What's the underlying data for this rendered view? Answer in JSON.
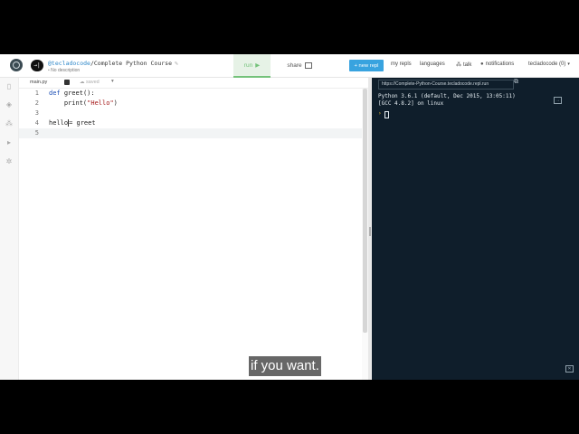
{
  "header": {
    "lang_badge": "→|",
    "user": "@tecladocode",
    "slash": "/",
    "repl_name": "Complete Python Course",
    "description": "No description",
    "run_label": "run",
    "share_label": "share",
    "new_repl_label": "+ new repl",
    "my_repls_label": "my repls",
    "languages_label": "languages",
    "talk_label": "talk",
    "notifications_label": "notifications",
    "account_label": "tecladocode (0)"
  },
  "editor": {
    "file_tab": "main.py",
    "saved_label": "saved",
    "lines": [
      {
        "num": "1"
      },
      {
        "num": "2"
      },
      {
        "num": "3"
      },
      {
        "num": "4"
      },
      {
        "num": "5"
      }
    ],
    "code": {
      "l1_kw": "def",
      "l1_rest": " greet():",
      "l2_call": "    print(",
      "l2_str": "\"Hello\"",
      "l2_end": ")",
      "l4_left": "hello",
      "l4_right": "= greet"
    }
  },
  "console": {
    "url": "https://Complete-Python-Course.tecladocode.repl.run",
    "line1": "Python 3.6.1 (default, Dec 2015, 13:05:11)",
    "line2": "[GCC 4.8.2] on linux",
    "prompt": "›"
  },
  "subtitle": "if you want.",
  "colors": {
    "accent": "#38a3df",
    "run_green": "#74c27a",
    "console_bg": "#0f1e2b"
  },
  "icons": [
    "replit-logo-icon",
    "files-icon",
    "packages-icon",
    "database-icon",
    "debugger-icon",
    "settings-icon",
    "pencil-icon",
    "play-icon",
    "share-icon",
    "chat-icon",
    "bell-icon",
    "chevron-down-icon",
    "external-link-icon",
    "clear-console-icon",
    "console-toggle-icon"
  ]
}
